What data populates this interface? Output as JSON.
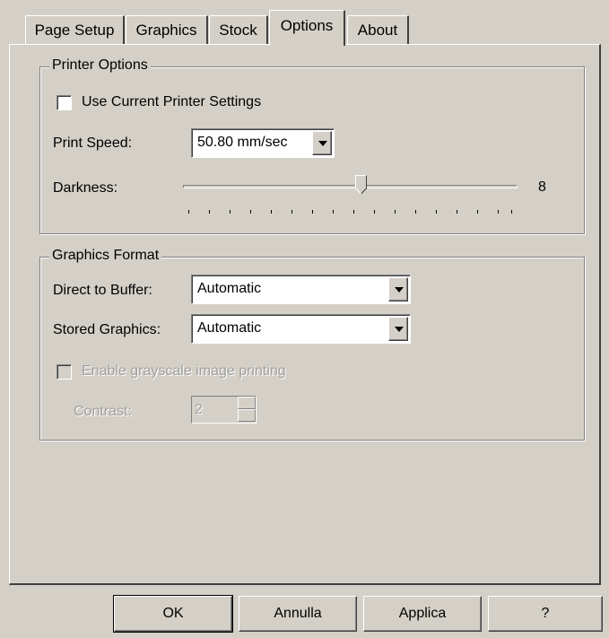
{
  "tabs": [
    {
      "label": "Page Setup"
    },
    {
      "label": "Graphics"
    },
    {
      "label": "Stock"
    },
    {
      "label": "Options"
    },
    {
      "label": "About"
    }
  ],
  "printer_options": {
    "legend": "Printer Options",
    "use_current_label": "Use Current Printer Settings",
    "use_current_checked": false,
    "print_speed_label": "Print Speed:",
    "print_speed_value": "50.80 mm/sec",
    "darkness_label": "Darkness:",
    "darkness_value": "8"
  },
  "graphics_format": {
    "legend": "Graphics Format",
    "direct_label": "Direct to Buffer:",
    "direct_value": "Automatic",
    "stored_label": "Stored Graphics:",
    "stored_value": "Automatic",
    "grayscale_label": "Enable grayscale image printing",
    "grayscale_checked": false,
    "contrast_label": "Contrast:",
    "contrast_value": "2"
  },
  "buttons": {
    "ok": "OK",
    "cancel": "Annulla",
    "apply": "Applica",
    "help": "?"
  },
  "colors": {
    "face": "#d4d0c8",
    "highlight": "#ffffff",
    "shadow": "#808080",
    "dark_shadow": "#404040",
    "disabled_text": "#a0a0a0"
  }
}
